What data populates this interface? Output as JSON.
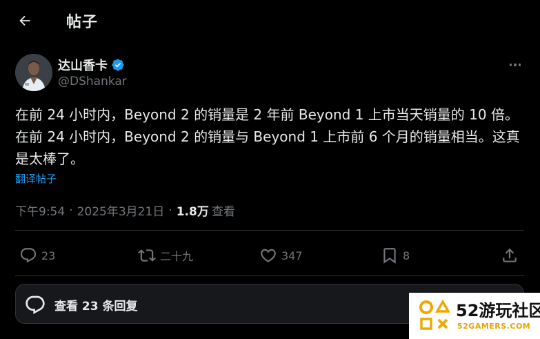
{
  "header": {
    "title": "帖子"
  },
  "author": {
    "name": "达山香卡",
    "handle": "@DShankar",
    "verified": true,
    "verified_color": "#1d9bf0"
  },
  "post": {
    "text": "在前 24 小时内，Beyond 2 的销量是 2 年前 Beyond 1 上市当天销量的 10 倍。在前 24 小时内，Beyond 2 的销量与 Beyond 1 上市前 6 个月的销量相当。这真是太棒了。",
    "translate_label": "翻译帖子"
  },
  "meta": {
    "time": "下午9:54",
    "date": "2025年3月21日",
    "views_count": "1.8万",
    "views_label": "查看",
    "separator": "·"
  },
  "actions": {
    "reply_count": "23",
    "repost_count": "二十九",
    "like_count": "347",
    "bookmark_count": "8"
  },
  "replies": {
    "label": "查看 23 条回复"
  },
  "watermark": {
    "brand_num": "52",
    "brand_text": "游玩社区",
    "url": "52GAMERS.COM"
  },
  "colors": {
    "background": "#000000",
    "text": "#e7e9ea",
    "muted": "#71767b",
    "link": "#1d9bf0",
    "border": "#2f3336"
  }
}
